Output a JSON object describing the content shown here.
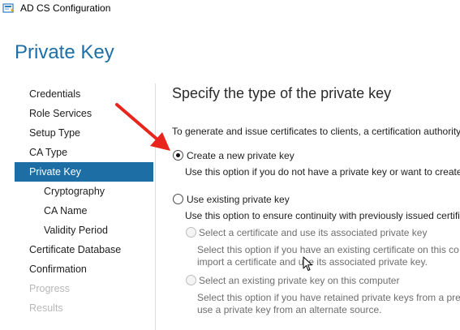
{
  "window": {
    "title": "AD CS Configuration"
  },
  "page": {
    "title": "Private Key"
  },
  "sidebar": {
    "items": [
      {
        "label": "Credentials",
        "state": "normal"
      },
      {
        "label": "Role Services",
        "state": "normal"
      },
      {
        "label": "Setup Type",
        "state": "normal"
      },
      {
        "label": "CA Type",
        "state": "normal"
      },
      {
        "label": "Private Key",
        "state": "active"
      },
      {
        "label": "Cryptography",
        "state": "sub"
      },
      {
        "label": "CA Name",
        "state": "sub"
      },
      {
        "label": "Validity Period",
        "state": "sub"
      },
      {
        "label": "Certificate Database",
        "state": "normal"
      },
      {
        "label": "Confirmation",
        "state": "normal"
      },
      {
        "label": "Progress",
        "state": "disabled"
      },
      {
        "label": "Results",
        "state": "disabled"
      }
    ]
  },
  "main": {
    "heading": "Specify the type of the private key",
    "intro": "To generate and issue certificates to clients, a certification authority",
    "options": {
      "create_new": {
        "label": "Create a new private key",
        "description": "Use this option if you do not have a private key or want to create",
        "selected": true
      },
      "use_existing": {
        "label": "Use existing private key",
        "description": "Use this option to ensure continuity with previously issued certifi",
        "selected": false
      },
      "select_certificate": {
        "label": "Select a certificate and use its associated private key",
        "description_line1": "Select this option if you have an existing certificate on this co",
        "description_line2": "import a certificate and use its associated private key.",
        "enabled": false
      },
      "select_existing_key": {
        "label": "Select an existing private key on this computer",
        "description_line1": "Select this option if you have retained private keys from a pre",
        "description_line2": "use a private key from an alternate source.",
        "enabled": false
      }
    }
  },
  "colors": {
    "accent": "#1c6ea4",
    "title": "#1d6fa5",
    "arrow": "#e8241c",
    "disabled_text": "#b8b8b8"
  },
  "icons": {
    "app": "ad-cs-server-icon",
    "annotation": "red-arrow-annotation",
    "cursor": "mouse-pointer-icon"
  }
}
